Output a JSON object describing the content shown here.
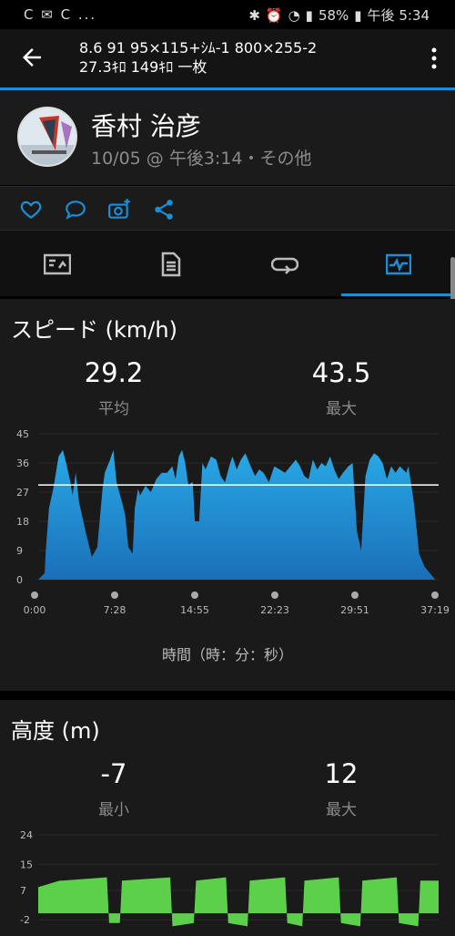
{
  "status_bar": {
    "left_text": "C ✉ C ...",
    "battery": "58%",
    "time": "午後 5:34"
  },
  "app_bar": {
    "title_line1": "8.6 91 95×115+ｼﾑ-1 800×255-2",
    "title_line2": "27.3ｷﾛ 149ｷﾛ 一枚"
  },
  "profile": {
    "name": "香村 治彦",
    "meta": "10/05 @ 午後3:14・その他"
  },
  "tabs": [
    "summary",
    "details",
    "laps",
    "charts"
  ],
  "speed_section": {
    "title": "スピード (km/h)",
    "avg_value": "29.2",
    "avg_label": "平均",
    "max_value": "43.5",
    "max_label": "最大",
    "x_caption": "時間（時：分：秒）"
  },
  "altitude_section": {
    "title": "高度 (m)",
    "min_value": "-7",
    "min_label": "最小",
    "max_value": "12",
    "max_label": "最大"
  },
  "colors": {
    "accent": "#1a8fd6",
    "speed_fill_top": "#29a9e6",
    "speed_fill_bottom": "#1a6fb8",
    "altitude_fill": "#5cd04a"
  },
  "chart_data": [
    {
      "type": "area",
      "title": "スピード (km/h)",
      "xlabel": "時間（時：分：秒）",
      "ylabel": "",
      "x_tick_labels": [
        "0:00",
        "7:28",
        "14:55",
        "22:23",
        "29:51",
        "37:19"
      ],
      "y_tick_labels": [
        "0",
        "9",
        "18",
        "27",
        "36",
        "45"
      ],
      "ylim": [
        0,
        45
      ],
      "xlim_minutes": [
        0,
        37.3167
      ],
      "avg_line": 29.2,
      "series": [
        {
          "x_minutes": [
            0,
            0.6,
            0.7,
            1.0,
            1.4,
            1.9,
            2.3,
            2.6,
            3.0,
            3.2,
            3.5,
            3.8,
            4.4,
            5.0,
            5.5,
            6.0,
            6.2,
            6.7,
            7.0,
            7.3,
            7.8,
            8.1,
            8.4,
            8.8,
            9.0,
            9.3,
            9.5,
            10.0,
            10.5,
            11.0,
            11.5,
            12.0,
            12.5,
            12.8,
            13.1,
            13.4,
            13.7,
            14.0,
            14.3,
            14.4,
            14.6,
            15.0,
            15.3,
            15.6,
            16.1,
            16.6,
            17.0,
            17.4,
            17.8,
            18.1,
            18.5,
            18.9,
            19.3,
            19.8,
            20.2,
            20.6,
            21.0,
            21.5,
            22.0,
            22.5,
            23.0,
            23.5,
            24.0,
            24.4,
            24.8,
            25.2,
            25.6,
            26.0,
            26.4,
            26.8,
            27.2,
            27.6,
            28.0,
            28.4,
            28.9,
            29.3,
            29.7,
            30.1,
            30.5,
            30.9,
            31.3,
            31.7,
            32.1,
            32.5,
            32.9,
            33.3,
            33.7,
            34.0,
            34.3,
            34.5,
            35.0,
            35.5,
            36.0,
            36.5,
            37.0
          ],
          "values": [
            0,
            2,
            9,
            22,
            28,
            38,
            40,
            36,
            30,
            26,
            33,
            24,
            15,
            7,
            10,
            28,
            33,
            37,
            40,
            30,
            24,
            20,
            10,
            8,
            22,
            28,
            26,
            29,
            27,
            31,
            33,
            33,
            35,
            31,
            38,
            40,
            36,
            29,
            30,
            30,
            18,
            18,
            36,
            34,
            38,
            37,
            32,
            30,
            35,
            38,
            34,
            37,
            39,
            35,
            32,
            34,
            33,
            30,
            35,
            34,
            33,
            35,
            37,
            35,
            32,
            31,
            37,
            34,
            36,
            35,
            38,
            34,
            31,
            33,
            35,
            36,
            15,
            9,
            32,
            37,
            39,
            38,
            36,
            31,
            35,
            33,
            35,
            34,
            33,
            35,
            24,
            8,
            4,
            2,
            0
          ],
          "name": ""
        }
      ]
    },
    {
      "type": "area",
      "title": "高度 (m)",
      "y_tick_labels": [
        "-2",
        "7",
        "15",
        "24"
      ],
      "ylim": [
        -5,
        24
      ],
      "series": [
        {
          "x_minutes": [
            0,
            2.0,
            2.2,
            6.4,
            6.6,
            7.6,
            7.8,
            12.3,
            12.5,
            14.5,
            14.7,
            17.5,
            17.7,
            19.5,
            19.7,
            23.0,
            23.2,
            24.6,
            24.8,
            28.0,
            28.2,
            30.0,
            30.2,
            33.4,
            33.6,
            35.4,
            35.6,
            37.3
          ],
          "values": [
            8,
            10,
            10,
            11,
            -3,
            -3,
            10,
            11,
            -4,
            -3,
            10,
            11,
            -3,
            -4,
            10,
            11,
            -3,
            -4,
            10,
            11,
            -3,
            -4,
            10,
            11,
            -3,
            -4,
            10,
            10
          ],
          "name": ""
        }
      ]
    }
  ]
}
